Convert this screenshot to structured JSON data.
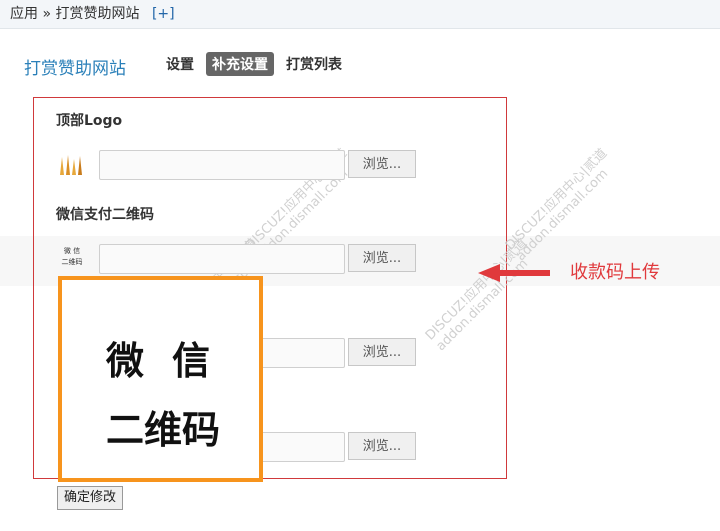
{
  "breadcrumb": {
    "app": "应用",
    "separator": "»",
    "page": "打赏赞助网站",
    "add": "[+]"
  },
  "header": {
    "title": "打赏赞助网站"
  },
  "tabs": [
    {
      "label": "设置",
      "active": false
    },
    {
      "label": "补充设置",
      "active": true
    },
    {
      "label": "打赏列表",
      "active": false
    }
  ],
  "form": {
    "sections": [
      {
        "label": "顶部Logo",
        "browse": "浏览..."
      },
      {
        "label": "微信支付二维码",
        "browse": "浏览...",
        "thumb_line1": "微 信",
        "thumb_line2": "二维码"
      },
      {
        "label": "",
        "browse": "浏览..."
      },
      {
        "label": "",
        "browse": "浏览..."
      }
    ],
    "submit": "确定修改"
  },
  "preview": {
    "line1": "微信",
    "line2": "二维码"
  },
  "annotation": {
    "text": "收款码上传"
  },
  "watermark": {
    "text1": "DISCUZ!应用中心|贰道",
    "text2": "addon.dismall.com"
  },
  "colors": {
    "accent": "#2b80b9",
    "annotation": "#e0393c",
    "highlight": "#f7941d",
    "frame": "#d0393b"
  }
}
